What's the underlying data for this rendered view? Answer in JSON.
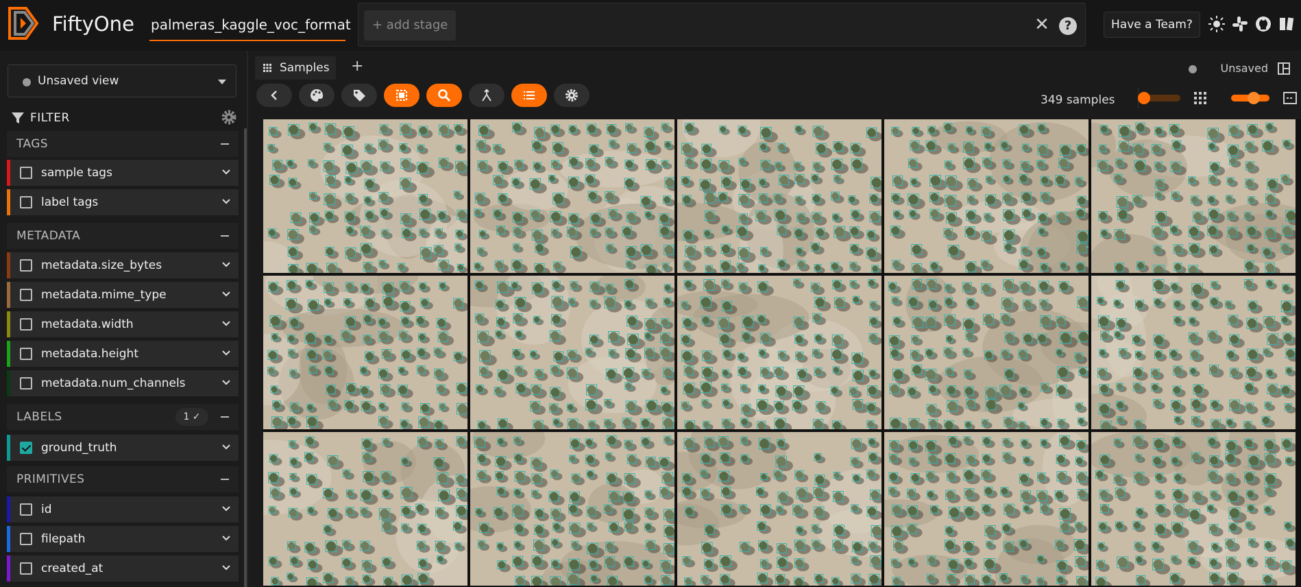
{
  "header": {
    "brand": "FiftyOne",
    "dataset_name": "palmeras_kaggle_voc_format",
    "add_stage_label": "+ add stage",
    "team_button": "Have a Team?",
    "icons": [
      "theme-toggle-icon",
      "slack-icon",
      "github-icon",
      "docs-icon"
    ]
  },
  "sidebar": {
    "view_selector": "Unsaved view",
    "filter_label": "FILTER",
    "groups": {
      "tags": "TAGS",
      "metadata": "METADATA",
      "labels": "LABELS",
      "labels_badge": "1 ✓",
      "primitives": "PRIMITIVES"
    },
    "fields": [
      {
        "label": "sample tags",
        "color": "#d7191c",
        "checked": false
      },
      {
        "label": "label tags",
        "color": "#e8730c",
        "checked": false
      },
      {
        "label": "metadata.size_bytes",
        "color": "#8a3b12",
        "checked": false
      },
      {
        "label": "metadata.mime_type",
        "color": "#9b6a3c",
        "checked": false
      },
      {
        "label": "metadata.width",
        "color": "#8a8a12",
        "checked": false
      },
      {
        "label": "metadata.height",
        "color": "#18a318",
        "checked": false
      },
      {
        "label": "metadata.num_channels",
        "color": "#0b3b12",
        "checked": false
      },
      {
        "label": "ground_truth",
        "color": "#0d9a94",
        "checked": true
      },
      {
        "label": "id",
        "color": "#1a1aa8",
        "checked": false
      },
      {
        "label": "filepath",
        "color": "#1a6be0",
        "checked": false
      },
      {
        "label": "created_at",
        "color": "#7a1ad0",
        "checked": false
      }
    ]
  },
  "main": {
    "tab_label": "Samples",
    "add_tab": "+",
    "status": "Unsaved",
    "sample_count": "349 samples"
  },
  "colors": {
    "accent": "#ff6d04",
    "box": "#2ab3ad"
  }
}
